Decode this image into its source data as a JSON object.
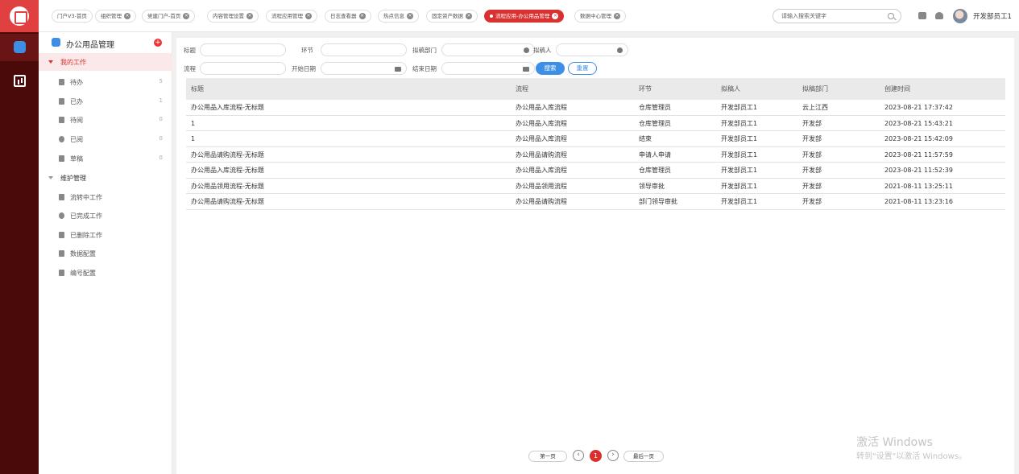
{
  "tabs": [
    {
      "label": "门户V3-首页",
      "closable": false
    },
    {
      "label": "组织管理",
      "closable": true
    },
    {
      "label": "党建门户-首页",
      "closable": true
    },
    {
      "label": "内容管理设置",
      "closable": true
    },
    {
      "label": "流程应用管理",
      "closable": true
    },
    {
      "label": "日志查看器",
      "closable": true
    },
    {
      "label": "热点信息",
      "closable": true
    },
    {
      "label": "固定资产数据",
      "closable": true
    },
    {
      "label": "流程应用-办公用品管理",
      "closable": true,
      "active": true
    },
    {
      "label": "数据中心管理",
      "closable": true
    }
  ],
  "search": {
    "placeholder": "请输入搜索关键字"
  },
  "user": {
    "name": "开发部员工1"
  },
  "sidebar": {
    "title": "办公用品管理",
    "groups": [
      {
        "label": "我的工作",
        "active": true,
        "items": [
          {
            "label": "待办",
            "count": "5"
          },
          {
            "label": "已办",
            "count": "1"
          },
          {
            "label": "待阅",
            "count": "0"
          },
          {
            "label": "已阅",
            "count": "0"
          },
          {
            "label": "草稿",
            "count": "0"
          }
        ]
      },
      {
        "label": "维护管理",
        "active": false,
        "items": [
          {
            "label": "流转中工作"
          },
          {
            "label": "已完成工作"
          },
          {
            "label": "已删除工作"
          },
          {
            "label": "数据配置"
          },
          {
            "label": "编号配置"
          }
        ]
      }
    ]
  },
  "filters": {
    "title_label": "标题",
    "node_label": "环节",
    "dept_label": "拟稿部门",
    "drafter_label": "拟稿人",
    "flow_label": "流程",
    "start_label": "开始日期",
    "end_label": "结束日期",
    "search_btn": "搜索",
    "reset_btn": "重置"
  },
  "table": {
    "headers": [
      "标题",
      "流程",
      "环节",
      "拟稿人",
      "拟稿部门",
      "创建时间"
    ],
    "rows": [
      [
        "办公用品入库流程-无标题",
        "办公用品入库流程",
        "仓库管理员",
        "开发部员工1",
        "云上江西",
        "2023-08-21 17:37:42"
      ],
      [
        "1",
        "办公用品入库流程",
        "仓库管理员",
        "开发部员工1",
        "开发部",
        "2023-08-21 15:43:21"
      ],
      [
        "1",
        "办公用品入库流程",
        "结束",
        "开发部员工1",
        "开发部",
        "2023-08-21 15:42:09"
      ],
      [
        "办公用品请购流程-无标题",
        "办公用品请购流程",
        "申请人申请",
        "开发部员工1",
        "开发部",
        "2023-08-21 11:57:59"
      ],
      [
        "办公用品入库流程-无标题",
        "办公用品入库流程",
        "仓库管理员",
        "开发部员工1",
        "开发部",
        "2023-08-21 11:52:39"
      ],
      [
        "办公用品领用流程-无标题",
        "办公用品领用流程",
        "领导审批",
        "开发部员工1",
        "开发部",
        "2021-08-11 13:25:11"
      ],
      [
        "办公用品请购流程-无标题",
        "办公用品请购流程",
        "部门领导审批",
        "开发部员工1",
        "开发部",
        "2021-08-11 13:23:16"
      ]
    ]
  },
  "pagination": {
    "first": "第一页",
    "current": "1",
    "last": "最后一页",
    "prev": "‹",
    "next": "›"
  },
  "watermark": {
    "line1": "激活 Windows",
    "line2": "转到\"设置\"以激活 Windows。"
  }
}
